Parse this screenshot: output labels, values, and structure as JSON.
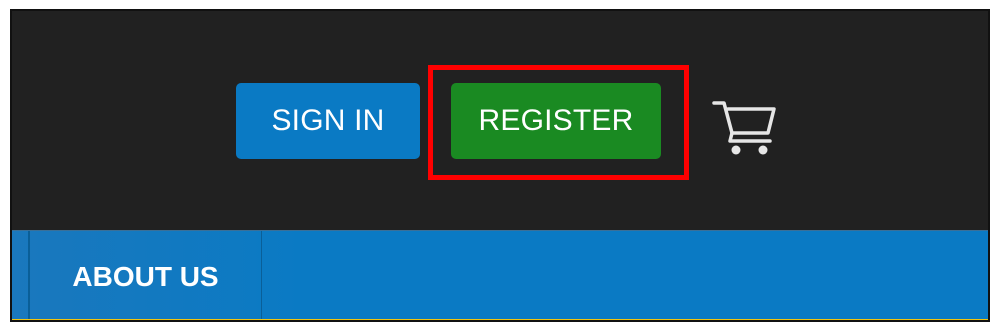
{
  "header": {
    "signin_label": "SIGN IN",
    "register_label": "REGISTER",
    "cart_icon": "shopping-cart-icon"
  },
  "nav": {
    "items": [
      {
        "label": "ABOUT US"
      }
    ]
  },
  "colors": {
    "header_bg": "#212121",
    "signin_bg": "#0a7ac4",
    "register_bg": "#1a8a22",
    "highlight": "#ff0000",
    "nav_bg": "#0a7ac4",
    "nav_strip": "#f1c40f"
  }
}
